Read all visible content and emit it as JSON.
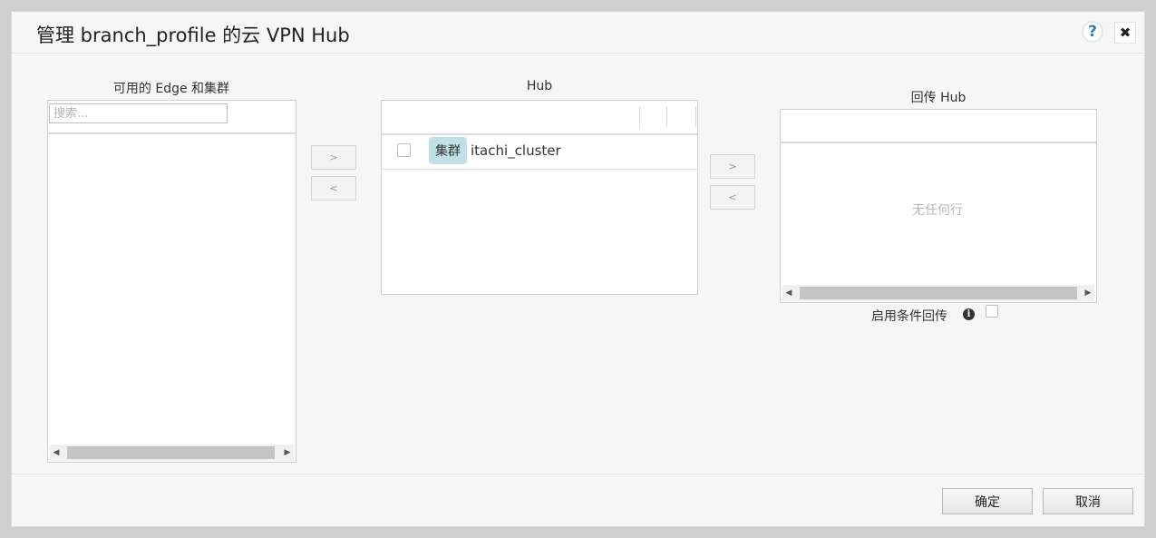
{
  "dialog": {
    "title": "管理 branch_profile 的云 VPN Hub",
    "help_icon": "?",
    "close_icon": "✖"
  },
  "available_panel": {
    "title": "可用的 Edge 和集群",
    "search_placeholder": "搜索..."
  },
  "transfer_buttons": {
    "add": ">",
    "remove": "<"
  },
  "hub_panel": {
    "title": "Hub",
    "rows": [
      {
        "badge": "集群",
        "name": "itachi_cluster"
      }
    ]
  },
  "backhaul_panel": {
    "title": "回传 Hub",
    "empty_text": "无任何行",
    "conditional_label": "启用条件回传",
    "info_icon": "i"
  },
  "footer": {
    "ok_label": "确定",
    "cancel_label": "取消"
  }
}
